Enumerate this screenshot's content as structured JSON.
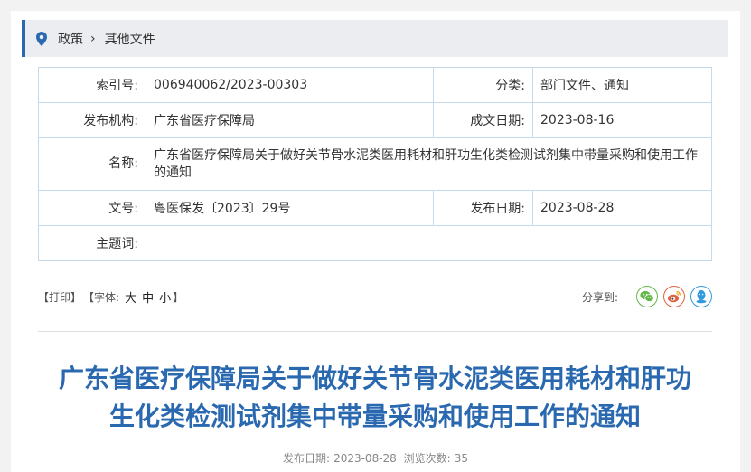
{
  "breadcrumb": {
    "items": [
      "政策",
      "其他文件"
    ],
    "separator": "›",
    "icon": "location-pin-icon"
  },
  "meta": {
    "index_label": "索引号:",
    "index_value": "006940062/2023-00303",
    "category_label": "分类:",
    "category_value": "部门文件、通知",
    "issuer_label": "发布机构:",
    "issuer_value": "广东省医疗保障局",
    "created_label": "成文日期:",
    "created_value": "2023-08-16",
    "name_label": "名称:",
    "name_value": "广东省医疗保障局关于做好关节骨水泥类医用耗材和肝功生化类检测试剂集中带量采购和使用工作的通知",
    "docno_label": "文号:",
    "docno_value": "粤医保发〔2023〕29号",
    "published_label": "发布日期:",
    "published_value": "2023-08-28",
    "subject_label": "主题词:",
    "subject_value": ""
  },
  "toolbar": {
    "print": "【打印】",
    "font_prefix": "【字体:",
    "font_large": "大",
    "font_medium": "中",
    "font_small": "小",
    "font_suffix": "】",
    "share_label": "分享到:",
    "share_icons": [
      "wechat-icon",
      "weibo-icon",
      "qq-icon"
    ]
  },
  "article": {
    "title_line1": "广东省医疗保障局关于做好关节骨水泥类医用耗材和肝功",
    "title_line2": "生化类检测试剂集中带量采购和使用工作的通知",
    "pub_date_label": "发布日期:",
    "pub_date": "2023-08-28",
    "views_label": "浏览次数:",
    "views": "35"
  },
  "colors": {
    "accent": "#2a69b0",
    "table_border": "#c5daea",
    "wechat": "#63b648",
    "weibo": "#e0613e",
    "qq": "#2e9adb"
  }
}
